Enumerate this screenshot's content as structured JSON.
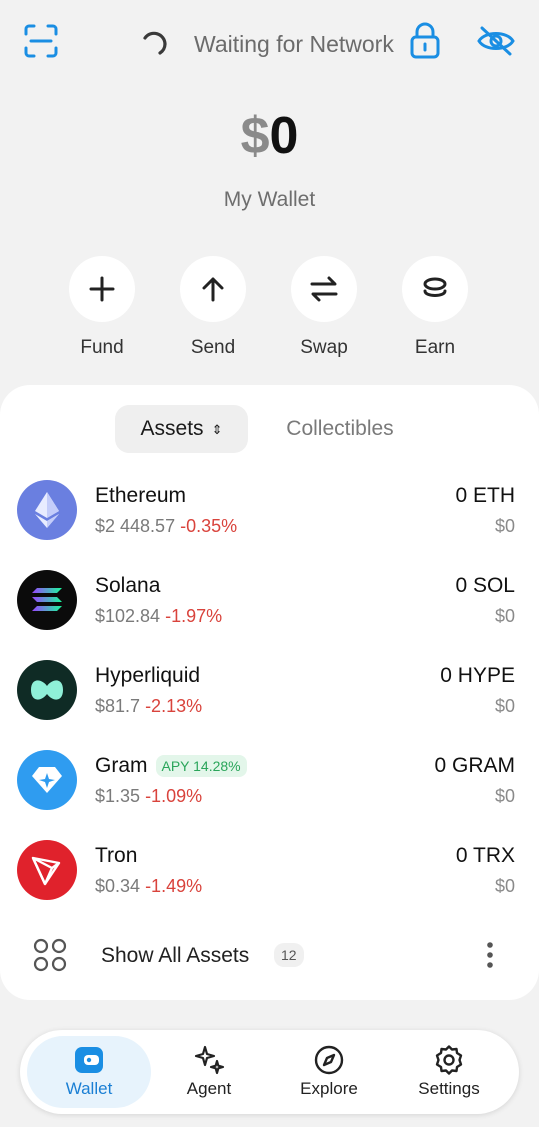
{
  "colors": {
    "accent": "#1a8ee3",
    "negative": "#d9433c",
    "positive": "#2aa55a",
    "background": "#f2f2f2"
  },
  "topbar": {
    "status_text": "Waiting for Network",
    "icons": [
      "scan-icon",
      "spinner-icon",
      "lock-icon",
      "eye-off-icon"
    ]
  },
  "balance": {
    "currency_symbol": "$",
    "amount": "0",
    "wallet_name": "My Wallet"
  },
  "actions": [
    {
      "label": "Fund",
      "icon": "plus-icon"
    },
    {
      "label": "Send",
      "icon": "arrow-up-icon"
    },
    {
      "label": "Swap",
      "icon": "swap-icon"
    },
    {
      "label": "Earn",
      "icon": "coins-icon"
    }
  ],
  "tabs": {
    "assets": "Assets",
    "assets_sort": "⇕",
    "collectibles": "Collectibles"
  },
  "assets": [
    {
      "name": "Ethereum",
      "price": "$2 448.57",
      "change": "-0.35%",
      "amount": "0 ETH",
      "usd": "$0",
      "icon": "ethereum-icon"
    },
    {
      "name": "Solana",
      "price": "$102.84",
      "change": "-1.97%",
      "amount": "0 SOL",
      "usd": "$0",
      "icon": "solana-icon"
    },
    {
      "name": "Hyperliquid",
      "price": "$81.7",
      "change": "-2.13%",
      "amount": "0 HYPE",
      "usd": "$0",
      "icon": "hyperliquid-icon"
    },
    {
      "name": "Gram",
      "badge": "APY 14.28%",
      "price": "$1.35",
      "change": "-1.09%",
      "amount": "0 GRAM",
      "usd": "$0",
      "icon": "gram-icon"
    },
    {
      "name": "Tron",
      "price": "$0.34",
      "change": "-1.49%",
      "amount": "0 TRX",
      "usd": "$0",
      "icon": "tron-icon"
    }
  ],
  "show_all": {
    "label": "Show All Assets",
    "count": "12"
  },
  "nav": [
    {
      "label": "Wallet",
      "icon": "wallet-icon",
      "active": true
    },
    {
      "label": "Agent",
      "icon": "sparkles-icon",
      "active": false
    },
    {
      "label": "Explore",
      "icon": "compass-icon",
      "active": false
    },
    {
      "label": "Settings",
      "icon": "gear-icon",
      "active": false
    }
  ]
}
